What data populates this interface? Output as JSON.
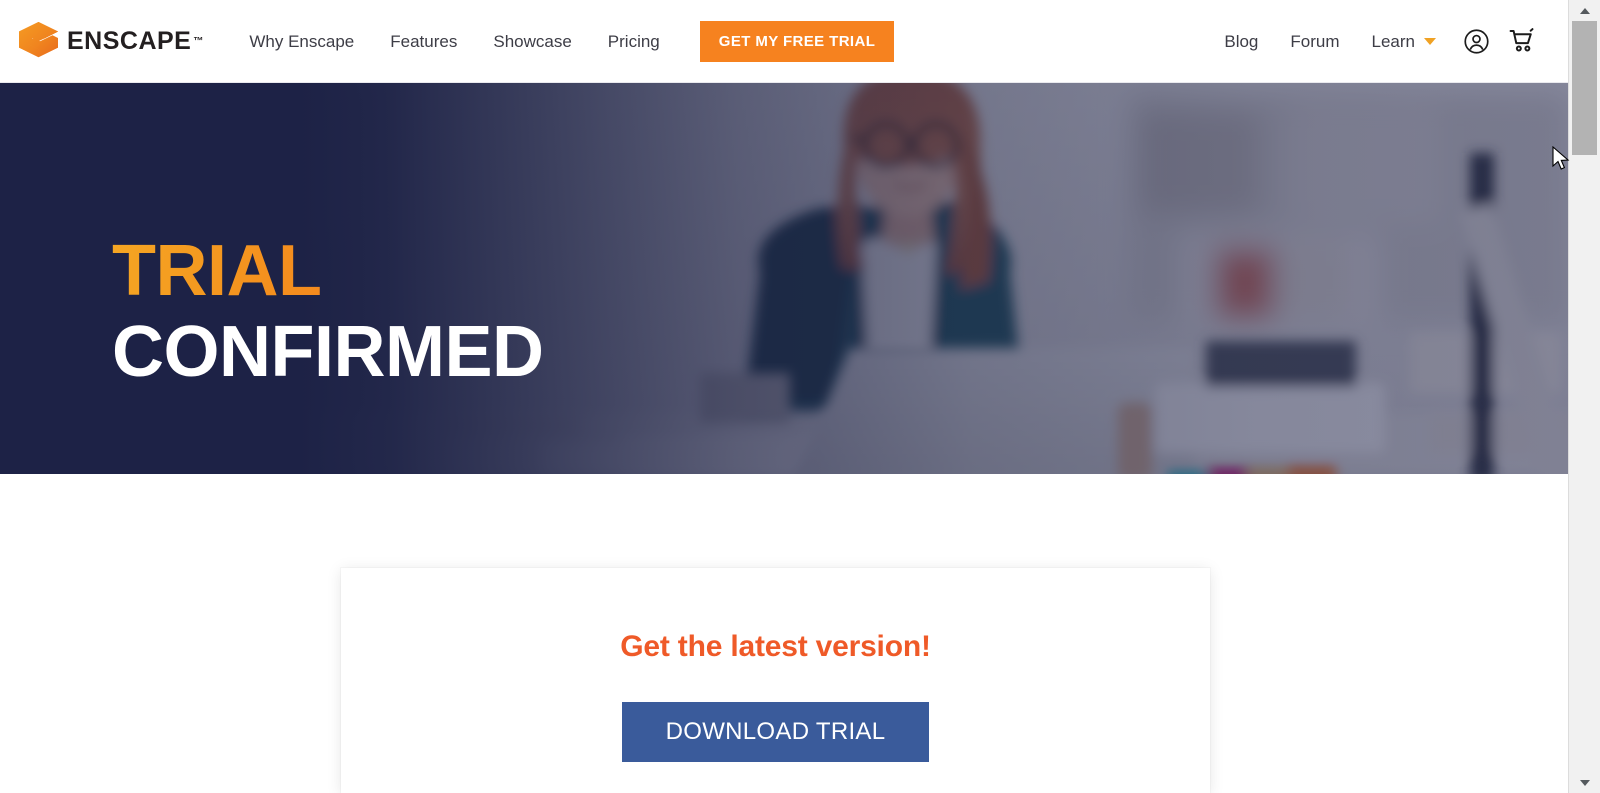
{
  "brand": {
    "logo_icon": "enscape-e-logo-icon",
    "name": "ENSCAPE",
    "trademark": "™",
    "accent_orange": "#f6821f",
    "navy": "#1d2246",
    "heading_orange": "#ef5a28",
    "button_blue": "#3a5b9b"
  },
  "nav": {
    "primary": [
      {
        "label": "Why Enscape"
      },
      {
        "label": "Features"
      },
      {
        "label": "Showcase"
      },
      {
        "label": "Pricing"
      }
    ],
    "cta": {
      "label": "GET MY FREE TRIAL"
    },
    "secondary": [
      {
        "label": "Blog"
      },
      {
        "label": "Forum"
      }
    ],
    "learn": {
      "label": "Learn",
      "caret_icon": "chevron-down-icon"
    },
    "account_icon": "user-account-icon",
    "cart_icon": "shopping-cart-icon"
  },
  "hero": {
    "title_line1": "TRIAL",
    "title_line2": "CONFIRMED",
    "background_image_alt": "woman-with-glasses-working-at-laptop-in-studio"
  },
  "card": {
    "title": "Get the latest version!",
    "download_button": "DOWNLOAD TRIAL"
  },
  "scrollbar": {
    "up_icon": "scroll-up-arrow-icon",
    "down_icon": "scroll-down-arrow-icon",
    "thumb": "scrollbar-thumb"
  }
}
